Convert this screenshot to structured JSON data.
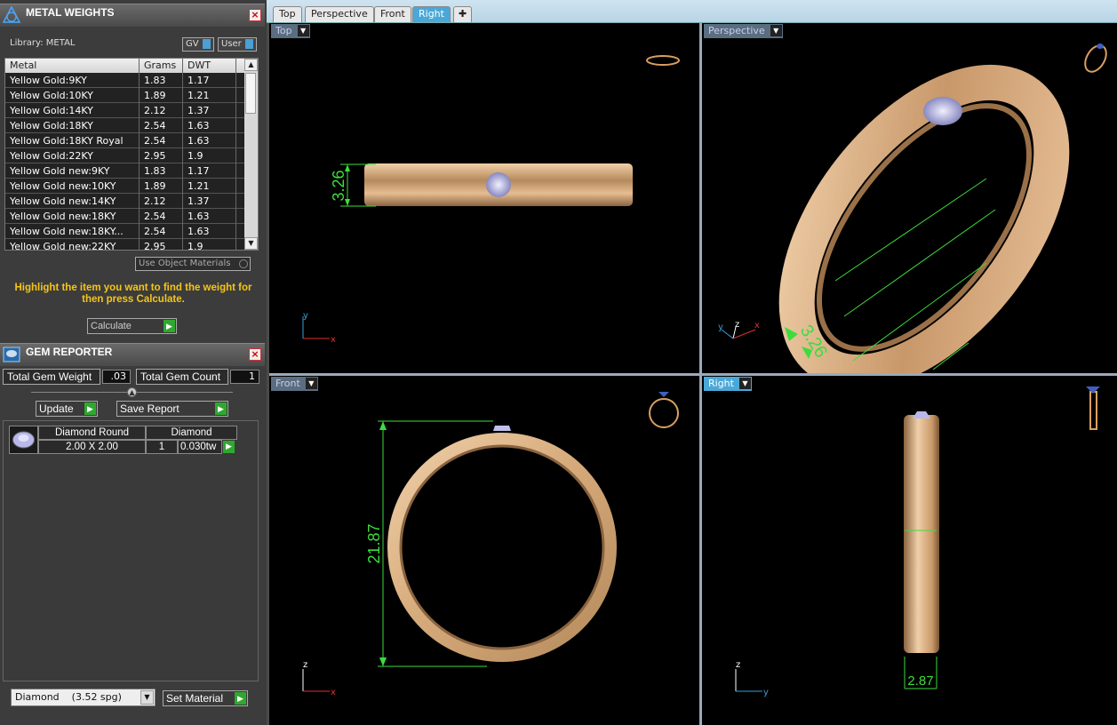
{
  "metal_panel": {
    "title": "METAL WEIGHTS",
    "library_label": "Library: METAL",
    "gv_label": "GV",
    "user_label": "User",
    "columns": [
      "Metal",
      "Grams",
      "DWT"
    ],
    "rows": [
      [
        "Yellow Gold:9KY",
        "1.83",
        "1.17"
      ],
      [
        "Yellow Gold:10KY",
        "1.89",
        "1.21"
      ],
      [
        "Yellow Gold:14KY",
        "2.12",
        "1.37"
      ],
      [
        "Yellow Gold:18KY",
        "2.54",
        "1.63"
      ],
      [
        "Yellow Gold:18KY Royal",
        "2.54",
        "1.63"
      ],
      [
        "Yellow Gold:22KY",
        "2.95",
        "1.9"
      ],
      [
        "Yellow Gold new:9KY",
        "1.83",
        "1.17"
      ],
      [
        "Yellow Gold new:10KY",
        "1.89",
        "1.21"
      ],
      [
        "Yellow Gold new:14KY",
        "2.12",
        "1.37"
      ],
      [
        "Yellow Gold new:18KY",
        "2.54",
        "1.63"
      ],
      [
        "Yellow Gold new:18KY...",
        "2.54",
        "1.63"
      ],
      [
        "Yellow Gold new:22KY",
        "2.95",
        "1.9"
      ]
    ],
    "use_object_materials": "Use Object Materials",
    "hint": "Highlight the item you want to find the weight for then press Calculate.",
    "calculate_label": "Calculate"
  },
  "gem_panel": {
    "title": "GEM REPORTER",
    "total_weight_label": "Total Gem Weight",
    "total_weight_value": ".03",
    "total_count_label": "Total Gem Count",
    "total_count_value": "1",
    "update_label": "Update",
    "save_report_label": "Save Report",
    "gem": {
      "shape": "Diamond Round",
      "size": "2.00 X 2.00",
      "material": "Diamond",
      "count": "1",
      "weight": "0.030tw"
    },
    "material_select": "Diamond    (3.52 spg)",
    "set_material_label": "Set Material"
  },
  "tabs": [
    "Top",
    "Perspective",
    "Front",
    "Right"
  ],
  "active_tab": "Right",
  "viewports": {
    "top": {
      "label": "Top",
      "dimension": "3.26",
      "axes": [
        "y",
        "x"
      ]
    },
    "perspective": {
      "label": "Perspective",
      "dimension": "3.26",
      "axes": [
        "y",
        "z",
        "x"
      ]
    },
    "front": {
      "label": "Front",
      "dimension": "21.87",
      "axes": [
        "z",
        "x"
      ]
    },
    "right": {
      "label": "Right",
      "dimension": "2.87",
      "axes": [
        "z",
        "y"
      ]
    }
  },
  "colors": {
    "gold": "#d9a878",
    "dimension": "#3ddc3d",
    "axis_x": "#e03030",
    "axis_y": "#3a9ed8",
    "axis_z": "#ffffff"
  }
}
